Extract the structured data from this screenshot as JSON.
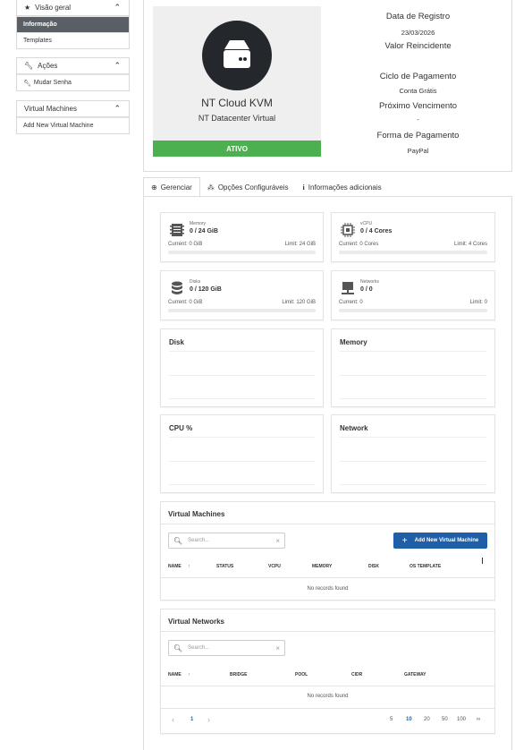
{
  "sidebar": {
    "overview": {
      "title": "Visão geral",
      "items": [
        "Informação",
        "Templates"
      ]
    },
    "actions": {
      "title": "Ações",
      "items": [
        "Mudar Senha"
      ]
    },
    "vms": {
      "title": "Virtual Machines",
      "items": [
        "Add New Virtual Machine"
      ]
    }
  },
  "product": {
    "name": "NT Cloud KVM",
    "group": "NT Datacenter Virtual",
    "status": "ATIVO",
    "status_color": "#4caf50"
  },
  "details": {
    "reg_label": "Data de Registro",
    "reg_value": "23/03/2026",
    "recurring_label": "Valor Reincidente",
    "cycle_label": "Ciclo de Pagamento",
    "cycle_value": "Conta Grátis",
    "due_label": "Próximo Vencimento",
    "due_value": "-",
    "method_label": "Forma de Pagamento",
    "method_value": "PayPal"
  },
  "tabs": [
    "Gerenciar",
    "Opções Configuráveis",
    "Informações adicionais"
  ],
  "resources": [
    {
      "icon": "memory-icon",
      "label": "Memory",
      "value": "0 / 24 GiB",
      "current": "Current: 0 GiB",
      "limit": "Limit: 24 GiB",
      "usage": 0
    },
    {
      "icon": "cpu-icon",
      "label": "vCPU",
      "value": "0 / 4 Cores",
      "current": "Current: 0 Cores",
      "limit": "Limit: 4 Cores",
      "usage": 0
    },
    {
      "icon": "disk-icon",
      "label": "Disks",
      "value": "0 / 120 GiB",
      "current": "Current: 0 GiB",
      "limit": "Limit: 120 GiB",
      "usage": 0
    },
    {
      "icon": "network-icon",
      "label": "Networks",
      "value": "0 / 0",
      "current": "Current: 0",
      "limit": "Limit: 0",
      "usage": 0
    }
  ],
  "graphs": [
    "Disk",
    "Memory",
    "CPU %",
    "Network"
  ],
  "vm_table": {
    "title": "Virtual Machines",
    "search_placeholder": "Search...",
    "add_label": "Add New Virtual Machine",
    "columns": [
      "NAME",
      "STATUS",
      "VCPU",
      "MEMORY",
      "DISK",
      "OS TEMPLATE"
    ],
    "sort_arrow": "↑",
    "empty": "No records found"
  },
  "net_table": {
    "title": "Virtual Networks",
    "search_placeholder": "Search...",
    "columns": [
      "NAME",
      "BRIDGE",
      "POOL",
      "CIDR",
      "GATEWAY"
    ],
    "sort_arrow": "↑",
    "empty": "No records found"
  },
  "pagination": {
    "prev": "‹",
    "page": "1",
    "next": "›",
    "sizes": [
      "5",
      "10",
      "20",
      "50",
      "100",
      "∞"
    ],
    "selected_size": "10"
  },
  "accent_color": "#1e5fa8"
}
